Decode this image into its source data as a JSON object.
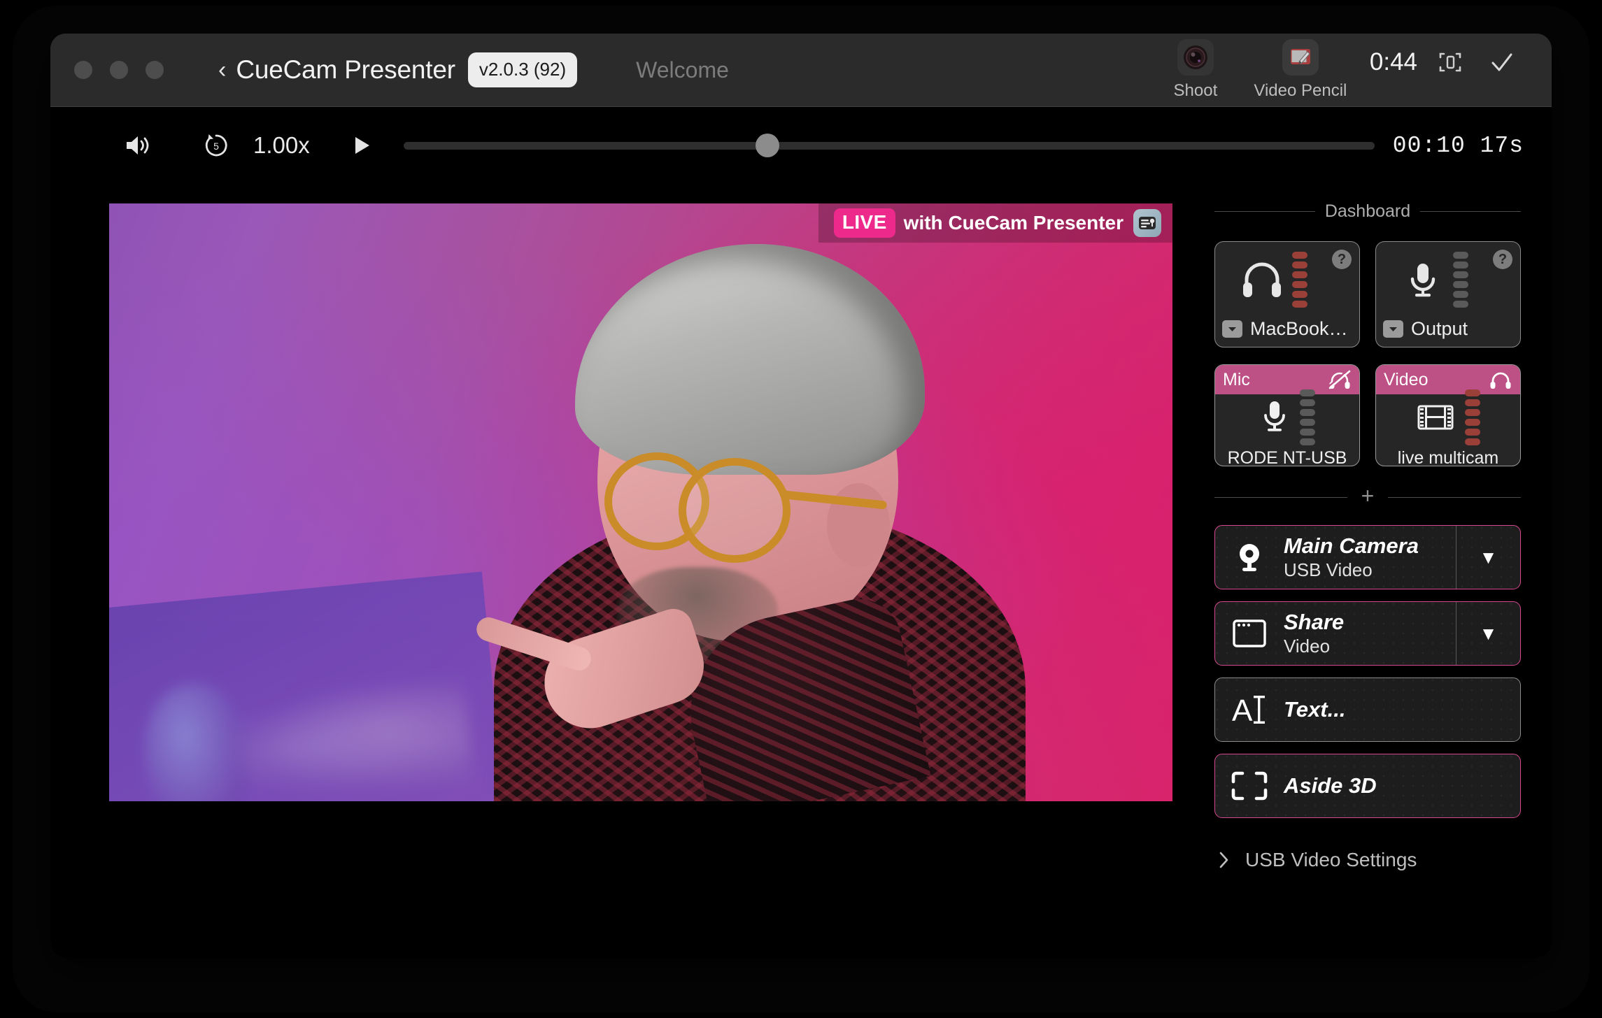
{
  "window": {
    "traffic_lights": [
      "close",
      "minimize",
      "zoom"
    ],
    "back_label": "‹",
    "app_title": "CueCam Presenter",
    "version_badge": "v2.0.3 (92)",
    "document_tab": "Welcome"
  },
  "toolbar": {
    "tools": [
      {
        "name": "shoot",
        "label": "Shoot",
        "icon": "camera-lens-icon"
      },
      {
        "name": "video-pencil",
        "label": "Video Pencil",
        "icon": "video-pencil-icon"
      }
    ],
    "session_time": "0:44",
    "copy_icon": "document-scan-icon",
    "confirm_icon": "checkmark-icon"
  },
  "playback": {
    "volume_icon": "speaker-wave-icon",
    "rewind_label": "5",
    "rewind_icon": "rewind-5-icon",
    "speed": "1.00x",
    "play_icon": "play-icon",
    "progress_percent": 37.5,
    "timecode": "00:10  17s"
  },
  "preview": {
    "live_badge": "LIVE",
    "live_text": "with CueCam Presenter",
    "logo_icon": "cuecam-logo-icon"
  },
  "dashboard": {
    "section_label": "Dashboard",
    "divider_plus": "+",
    "meters": [
      {
        "name": "headphones-meter",
        "icon": "headphones-icon",
        "device": "MacBook…",
        "help": "?",
        "led_count": 6,
        "led_hot": 6
      },
      {
        "name": "microphone-meter",
        "icon": "microphone-icon",
        "device": "Output",
        "help": "?",
        "led_count": 6,
        "led_hot": 0
      }
    ],
    "channels": [
      {
        "name": "mic-channel",
        "title": "Mic",
        "header_icon": "headphones-muted-icon",
        "body_icon": "microphone-icon",
        "label": "RODE NT-USB",
        "led_count": 6,
        "led_hot": 0
      },
      {
        "name": "video-channel",
        "title": "Video",
        "header_icon": "headphones-icon",
        "body_icon": "film-strip-icon",
        "label": "live multicam",
        "led_count": 6,
        "led_hot": 6
      }
    ],
    "sources": [
      {
        "name": "main-camera",
        "icon": "webcam-icon",
        "title": "Main Camera",
        "subtitle": "USB Video",
        "accent": "#d6488f",
        "has_caret": true,
        "caret": "▼"
      },
      {
        "name": "share",
        "icon": "window-share-icon",
        "title": "Share",
        "subtitle": "Video",
        "accent": "#d6488f",
        "has_caret": true,
        "caret": "▼"
      },
      {
        "name": "text",
        "icon": "text-cursor-icon",
        "title": "Text...",
        "subtitle": "",
        "accent": "#8d8d8d",
        "has_caret": false,
        "caret": ""
      },
      {
        "name": "aside-3d",
        "icon": "crop-frame-icon",
        "title": "Aside 3D",
        "subtitle": "",
        "accent": "#d6488f",
        "has_caret": false,
        "caret": ""
      }
    ],
    "settings": {
      "chevron": "›",
      "label": "USB Video Settings"
    }
  },
  "colors": {
    "accent_pink": "#d6488f",
    "live_pink": "#ed2a8b",
    "channel_header": "#bd5084",
    "led_hot": "#9b4038",
    "led_idle": "#5a5a5a",
    "window_chrome": "#2b2b2b"
  }
}
